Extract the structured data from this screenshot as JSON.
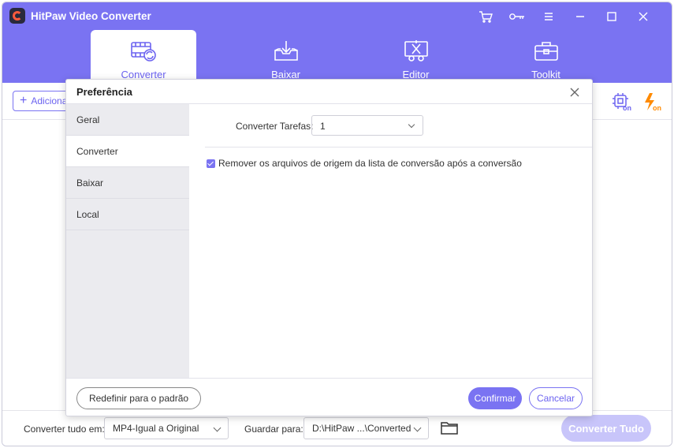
{
  "app": {
    "title": "HitPaw Video Converter"
  },
  "window_icons": [
    "cart-icon",
    "key-icon",
    "menu-icon",
    "minimize-icon",
    "maximize-icon",
    "close-icon"
  ],
  "nav": {
    "tabs": [
      {
        "label": "Converter",
        "icon": "film-convert-icon",
        "active": true
      },
      {
        "label": "Baixar",
        "icon": "download-tray-icon",
        "active": false
      },
      {
        "label": "Editor",
        "icon": "scissors-edit-icon",
        "active": false
      },
      {
        "label": "Toolkit",
        "icon": "toolbox-icon",
        "active": false
      }
    ]
  },
  "toolbar": {
    "add_label": "Adiciona"
  },
  "dialog": {
    "title": "Preferência",
    "sidebar": [
      {
        "label": "Geral",
        "active": false
      },
      {
        "label": "Converter",
        "active": true
      },
      {
        "label": "Baixar",
        "active": false
      },
      {
        "label": "Local",
        "active": false
      }
    ],
    "tasks_label": "Converter Tarefas:",
    "tasks_value": "1",
    "checkbox_label": "Remover os arquivos de origem da lista de conversão após a conversão",
    "checkbox_checked": true,
    "reset_label": "Redefinir para o padrão",
    "confirm_label": "Confirmar",
    "cancel_label": "Cancelar"
  },
  "bottom": {
    "convert_all_label": "Converter tudo em:",
    "format_value": "MP4-Igual a Original",
    "save_label": "Guardar para:",
    "path_value": "D:\\HitPaw ...\\Converted",
    "convert_all_button": "Converter Tudo"
  },
  "colors": {
    "accent": "#7a73f2",
    "accent_text": "#6c63f0",
    "disabled_button": "#c8c5fa",
    "bolt": "#ff8a00"
  }
}
